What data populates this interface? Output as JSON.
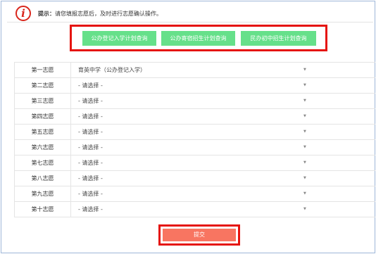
{
  "tip": {
    "icon_glyph": "i",
    "prefix": "提示：",
    "text": "请您填报志愿后，及时进行志愿确认操作。"
  },
  "query_buttons": [
    {
      "label": "公办登记入学计划查询"
    },
    {
      "label": "公办寄宿招生计划查询"
    },
    {
      "label": "民办初中招生计划查询"
    }
  ],
  "preferences": [
    {
      "label": "第一志愿",
      "value": "育英中学（公办登记入学）"
    },
    {
      "label": "第二志愿",
      "value": "- 请选择 -"
    },
    {
      "label": "第三志愿",
      "value": "- 请选择 -"
    },
    {
      "label": "第四志愿",
      "value": "- 请选择 -"
    },
    {
      "label": "第五志愿",
      "value": "- 请选择 -"
    },
    {
      "label": "第六志愿",
      "value": "- 请选择 -"
    },
    {
      "label": "第七志愿",
      "value": "- 请选择 -"
    },
    {
      "label": "第八志愿",
      "value": "- 请选择 -"
    },
    {
      "label": "第九志愿",
      "value": "- 请选择 -"
    },
    {
      "label": "第十志愿",
      "value": "- 请选择 -"
    }
  ],
  "dropdown_arrow": "▼",
  "submit": {
    "label": "提交"
  },
  "colors": {
    "annotation_red": "#e5140f",
    "query_button_green": "#66e08a",
    "submit_button": "#f87561",
    "info_icon_red": "#d9261c"
  }
}
